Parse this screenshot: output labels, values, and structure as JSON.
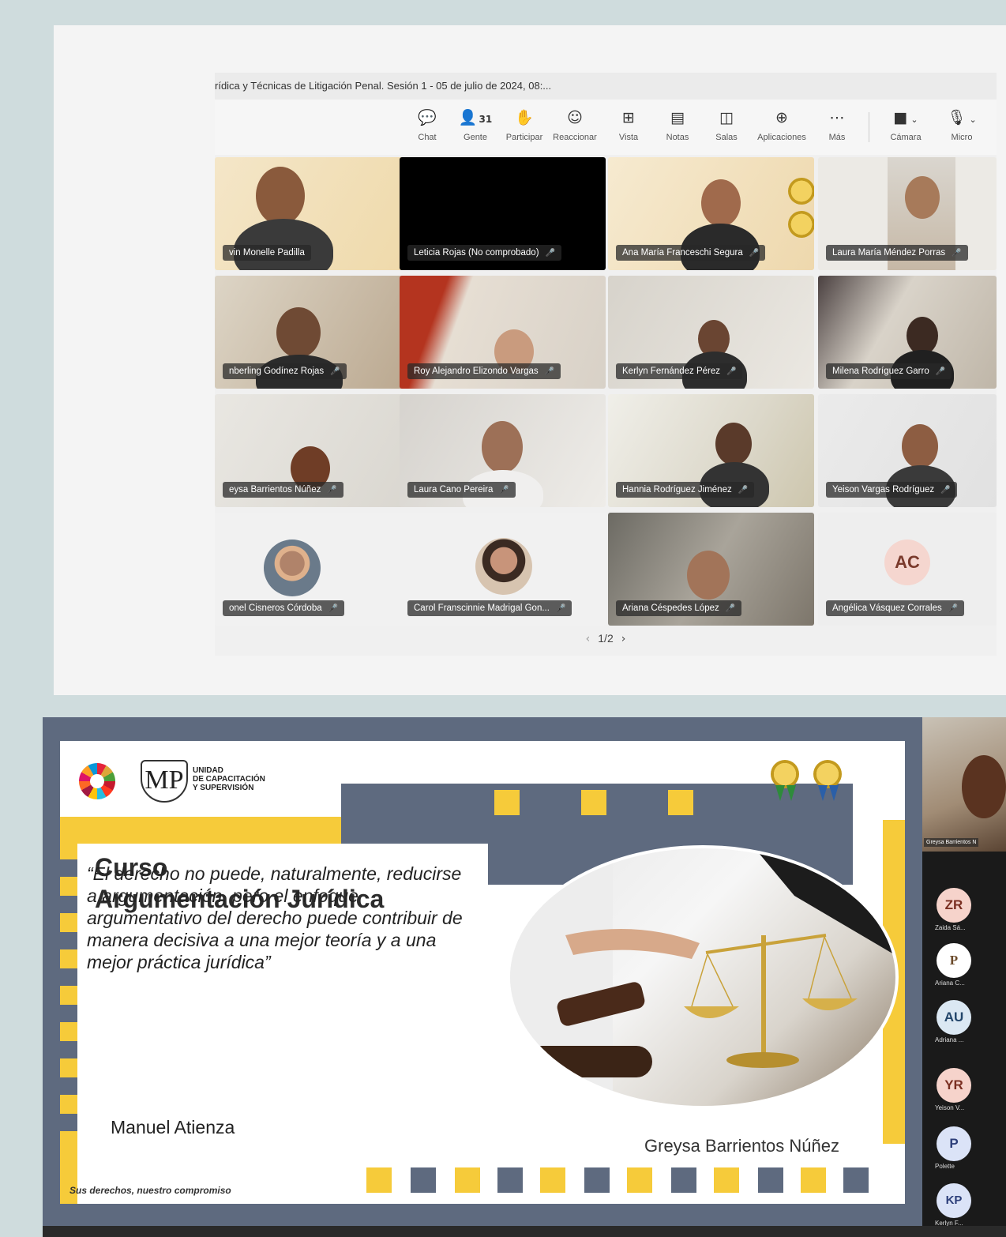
{
  "meeting": {
    "title": "rídica y Técnicas de Litigación Penal. Sesión 1 - 05 de julio de 2024, 08:...",
    "people_count": "31",
    "toolbar": [
      {
        "icon": "chat-icon",
        "glyph": "💬",
        "label": "Chat"
      },
      {
        "icon": "people-icon",
        "glyph": "👤",
        "label": "Gente"
      },
      {
        "icon": "raise-hand-icon",
        "glyph": "✋",
        "label": "Participar"
      },
      {
        "icon": "smiley-icon",
        "glyph": "☺",
        "label": "Reaccionar"
      },
      {
        "icon": "grid-view-icon",
        "glyph": "⊞",
        "label": "Vista"
      },
      {
        "icon": "notes-icon",
        "glyph": "▤",
        "label": "Notas"
      },
      {
        "icon": "rooms-icon",
        "glyph": "◫",
        "label": "Salas"
      },
      {
        "icon": "apps-icon",
        "glyph": "⊕",
        "label": "Aplicaciones"
      },
      {
        "icon": "more-icon",
        "glyph": "⋯",
        "label": "Más"
      },
      {
        "icon": "camera-icon",
        "glyph": "■",
        "label": "Cámara"
      },
      {
        "icon": "mic-icon",
        "glyph": "🎙",
        "label": "Micro"
      }
    ],
    "participants": [
      "vin Monelle Padilla",
      "Leticia Rojas (No comprobado)",
      "Ana María Franceschi Segura",
      "Laura María Méndez Porras",
      "nberling Godínez Rojas",
      "Roy Alejandro Elizondo Vargas",
      "Kerlyn Fernández Pérez",
      "Milena Rodríguez Garro",
      "eysa Barrientos Núñez",
      "Laura Cano Pereira",
      "Hannia Rodríguez Jiménez",
      "Yeison Vargas Rodríguez",
      "onel Cisneros Córdoba",
      "Carol Franscinnie Madrigal Gon...",
      "Ariana Céspedes López",
      "Angélica Vásquez Corrales"
    ],
    "avatar_initials": "AC",
    "pager": "1/2"
  },
  "slide": {
    "unit_text": "UNIDAD\nDE CAPACITACIÓN\nY SUPERVISIÓN",
    "mp_logo": "MP",
    "heading_line1": "Curso",
    "heading_line2": "Argumentación Jurídica",
    "quote": "“El derecho no puede, naturalmente, reducirse a argumentación, pero el enfoque argumentativo del derecho puede contribuir de manera decisiva a una mejor teoría y a una mejor práctica jurídica”",
    "author": "Manuel Atienza",
    "presenter": "Greysa Barrientos Núñez",
    "slogan": "Sus derechos, nuestro compromiso"
  },
  "side_panel": {
    "video_name": "Greysa Barrientos N",
    "attendees": [
      {
        "initials": "ZR",
        "name": "Zaida Sá..."
      },
      {
        "initials": "P",
        "name": "Ariana C..."
      },
      {
        "initials": "AU",
        "name": "Adriana ..."
      },
      {
        "initials": "YR",
        "name": "Yeison V..."
      },
      {
        "initials": "P",
        "name": "Polette"
      },
      {
        "initials": "KP",
        "name": "Kerlyn F..."
      }
    ]
  }
}
